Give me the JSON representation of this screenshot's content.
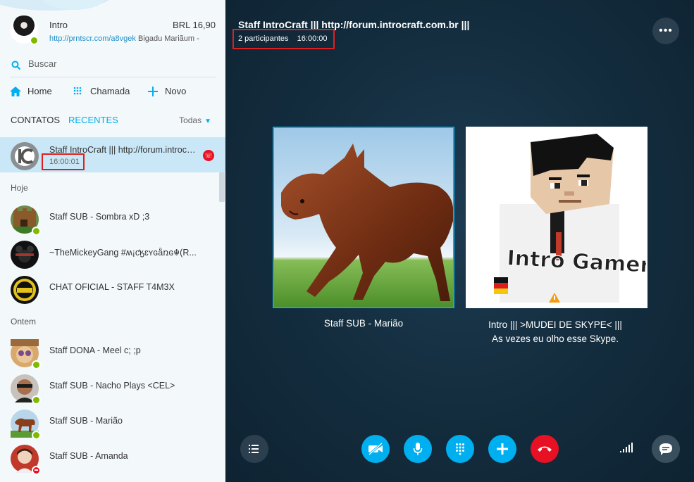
{
  "profile": {
    "name": "Intro",
    "balance": "BRL 16,90",
    "mood_link": "http://prntscr.com/a8vgek",
    "mood_text": "Bigadu Mariãum  -"
  },
  "search": {
    "label": "Buscar"
  },
  "nav": {
    "home": "Home",
    "call": "Chamada",
    "new": "Novo"
  },
  "tabs": {
    "contacts": "CONTATOS",
    "recent": "RECENTES",
    "filter": "Todas"
  },
  "active_conversation": {
    "title": "Staff IntroCraft ||| http://forum.introcraft.com.br |||",
    "duration": "16:00:01"
  },
  "sections": {
    "today": "Hoje",
    "earlier": "Ontem"
  },
  "recents_today": [
    {
      "name": "Staff SUB - Sombra xD ;3",
      "status": "online"
    },
    {
      "name": "~TheMickeyGang  #ʍ¡ƈӄɛʏɢǟռɢ☬(R...",
      "status": "none"
    },
    {
      "name": "CHAT OFICIAL - STAFF T4M3X",
      "status": "none"
    }
  ],
  "recents_yesterday": [
    {
      "name": "Staff DONA - Meel c; ;p",
      "status": "online"
    },
    {
      "name": "Staff SUB - Nacho Plays <CEL>",
      "status": "online"
    },
    {
      "name": "Staff SUB - Marião",
      "status": "online"
    },
    {
      "name": "Staff SUB - Amanda",
      "status": "dnd"
    }
  ],
  "call": {
    "title": "Staff IntroCraft ||| http://forum.introcraft.com.br |||",
    "participants": "2 participantes",
    "duration": "16:00:00",
    "participant1": "Staff SUB - Marião",
    "participant2_line1": "Intro ||| >MUDEI DE SKYPE< |||",
    "participant2_line2": "As vezes eu olho esse Skype.",
    "avatar2_text": "Intro GamerHD"
  },
  "colors": {
    "accent": "#00aff0",
    "hangup": "#e81123",
    "online": "#7fba00",
    "dark_bg": "#132c3d"
  }
}
